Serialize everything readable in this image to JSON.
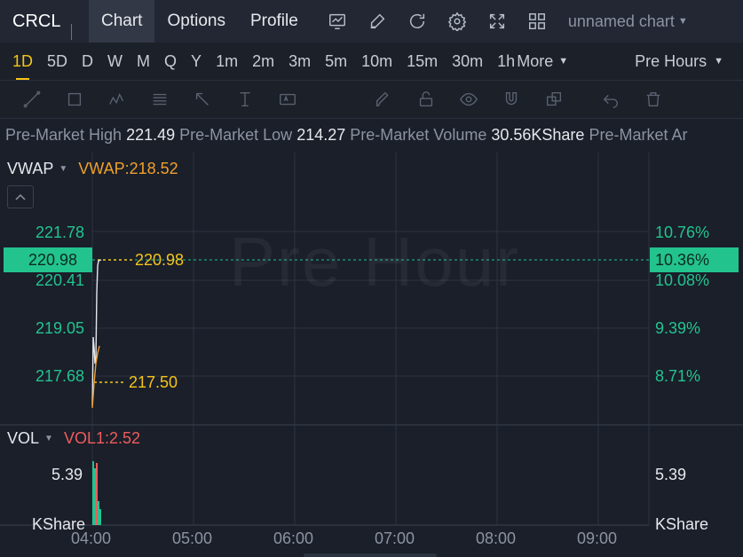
{
  "top": {
    "ticker": "CRCL",
    "tabs": [
      {
        "label": "Chart",
        "active": true
      },
      {
        "label": "Options",
        "active": false
      },
      {
        "label": "Profile",
        "active": false
      }
    ],
    "tool_icons": [
      "chart-settings-icon",
      "pencil-icon",
      "refresh-icon",
      "gear-icon",
      "fullscreen-icon",
      "grid-layout-icon"
    ],
    "chart_name": "unnamed chart"
  },
  "timeframes": {
    "items": [
      "1D",
      "5D",
      "D",
      "W",
      "M",
      "Q",
      "Y",
      "1m",
      "2m",
      "3m",
      "5m",
      "10m",
      "15m",
      "30m",
      "1h"
    ],
    "active": "1D",
    "more_label": "More",
    "session_label": "Pre Hours"
  },
  "drawing_tools": [
    "trend-line-icon",
    "rectangle-icon",
    "pattern-icon",
    "fibonacci-icon",
    "arrow-icon",
    "text-measure-icon",
    "text-label-icon",
    "brush-icon",
    "lock-icon",
    "eye-icon",
    "magnet-icon",
    "layers-icon",
    "undo-icon",
    "delete-icon"
  ],
  "infobar": {
    "items": [
      {
        "label": "Pre-Market High",
        "value": "221.49"
      },
      {
        "label": "Pre-Market Low",
        "value": "214.27"
      },
      {
        "label": "Pre-Market Volume",
        "value": "30.56KShare"
      },
      {
        "label": "Pre-Market Ar",
        "value": ""
      }
    ]
  },
  "price_pane": {
    "indicator_name": "VWAP",
    "indicator_value": "VWAP:218.52",
    "watermark": "Pre Hour",
    "left_axis": [
      "221.78",
      "220.41",
      "219.05",
      "217.68"
    ],
    "right_axis": [
      "10.76%",
      "10.08%",
      "9.39%",
      "8.71%"
    ],
    "current_price": "220.98",
    "current_pct": "10.36%",
    "marker_high": "220.98",
    "marker_low": "217.50"
  },
  "volume_pane": {
    "indicator_name": "VOL",
    "indicator_value": "VOL1:2.52",
    "left_value": "5.39",
    "left_unit": "KShare",
    "right_value": "5.39",
    "right_unit": "KShare"
  },
  "time_axis": [
    "04:00",
    "05:00",
    "06:00",
    "07:00",
    "08:00",
    "09:00"
  ],
  "colors": {
    "up": "#23c38e",
    "accent": "#f5c518",
    "vwap": "#f0a02a",
    "vol_label": "#ef5c5c",
    "background": "#1a1f2a"
  }
}
